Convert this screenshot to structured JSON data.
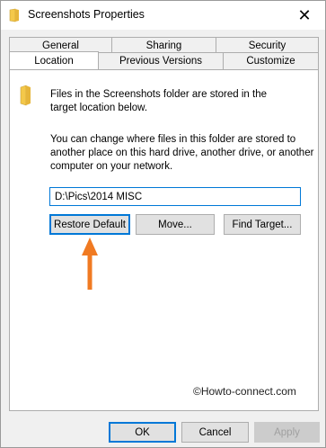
{
  "window": {
    "title": "Screenshots Properties",
    "close_glyph": "✕"
  },
  "tabs": {
    "row_top": [
      {
        "label": "General"
      },
      {
        "label": "Sharing"
      },
      {
        "label": "Security"
      }
    ],
    "row_bottom": [
      {
        "label": "Location",
        "active": true
      },
      {
        "label": "Previous Versions"
      },
      {
        "label": "Customize"
      }
    ]
  },
  "location": {
    "info_line1": "Files in the Screenshots folder are stored in the",
    "info_line2": "target location below.",
    "desc_line1": "You can change where files in this folder are stored to",
    "desc_line2": "another place on this hard drive, another drive, or another",
    "desc_line3": "computer on your network.",
    "path_value": "D:\\Pics\\2014 MISC",
    "restore_label": "Restore Default",
    "move_label": "Move...",
    "find_label": "Find Target..."
  },
  "watermark": "©Howto-connect.com",
  "footer": {
    "ok_label": "OK",
    "cancel_label": "Cancel",
    "apply_label": "Apply"
  },
  "colors": {
    "accent": "#0078d7",
    "arrow": "#f07a22",
    "folder": "#f4c84a"
  },
  "icons": [
    "folder-icon",
    "close-icon",
    "arrow-up-icon"
  ]
}
